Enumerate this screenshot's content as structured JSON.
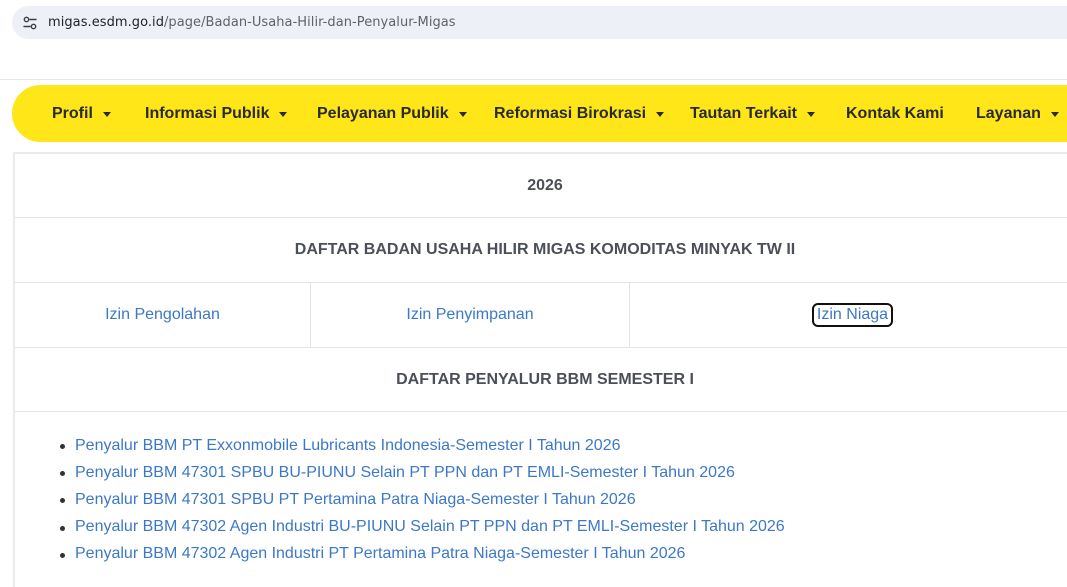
{
  "browser": {
    "url_host": "migas.esdm.go.id",
    "url_path": "/page/Badan-Usaha-Hilir-dan-Penyalur-Migas",
    "site_icon": "site-settings-icon"
  },
  "nav": {
    "items": [
      {
        "label": "Profil",
        "dropdown": true
      },
      {
        "label": "Informasi Publik",
        "dropdown": true
      },
      {
        "label": "Pelayanan Publik",
        "dropdown": true
      },
      {
        "label": "Reformasi Birokrasi",
        "dropdown": true
      },
      {
        "label": "Tautan Terkait",
        "dropdown": true
      },
      {
        "label": "Kontak Kami",
        "dropdown": false
      },
      {
        "label": "Layanan",
        "dropdown": true
      }
    ],
    "background_color": "#ffe619"
  },
  "content": {
    "year": "2026",
    "section1_title": "DAFTAR BADAN USAHA HILIR MIGAS KOMODITAS MINYAK TW II",
    "permits": [
      {
        "label": "Izin Pengolahan"
      },
      {
        "label": "Izin Penyimpanan"
      },
      {
        "label": "Izin Niaga"
      }
    ],
    "section2_title": "DAFTAR PENYALUR BBM SEMESTER I",
    "distributors": [
      {
        "label": "Penyalur BBM PT Exxonmobile Lubricants Indonesia-Semester I Tahun 2026"
      },
      {
        "label": "Penyalur BBM 47301 SPBU BU-PIUNU Selain PT PPN dan PT EMLI-Semester I Tahun 2026"
      },
      {
        "label": "Penyalur BBM 47301 SPBU PT Pertamina Patra Niaga-Semester I Tahun 2026"
      },
      {
        "label": "Penyalur BBM 47302 Agen Industri BU-PIUNU Selain PT PPN dan PT EMLI-Semester I Tahun 2026"
      },
      {
        "label": "Penyalur BBM 47302 Agen Industri PT Pertamina Patra Niaga-Semester I Tahun 2026"
      }
    ],
    "link_color": "#3c78c8"
  }
}
